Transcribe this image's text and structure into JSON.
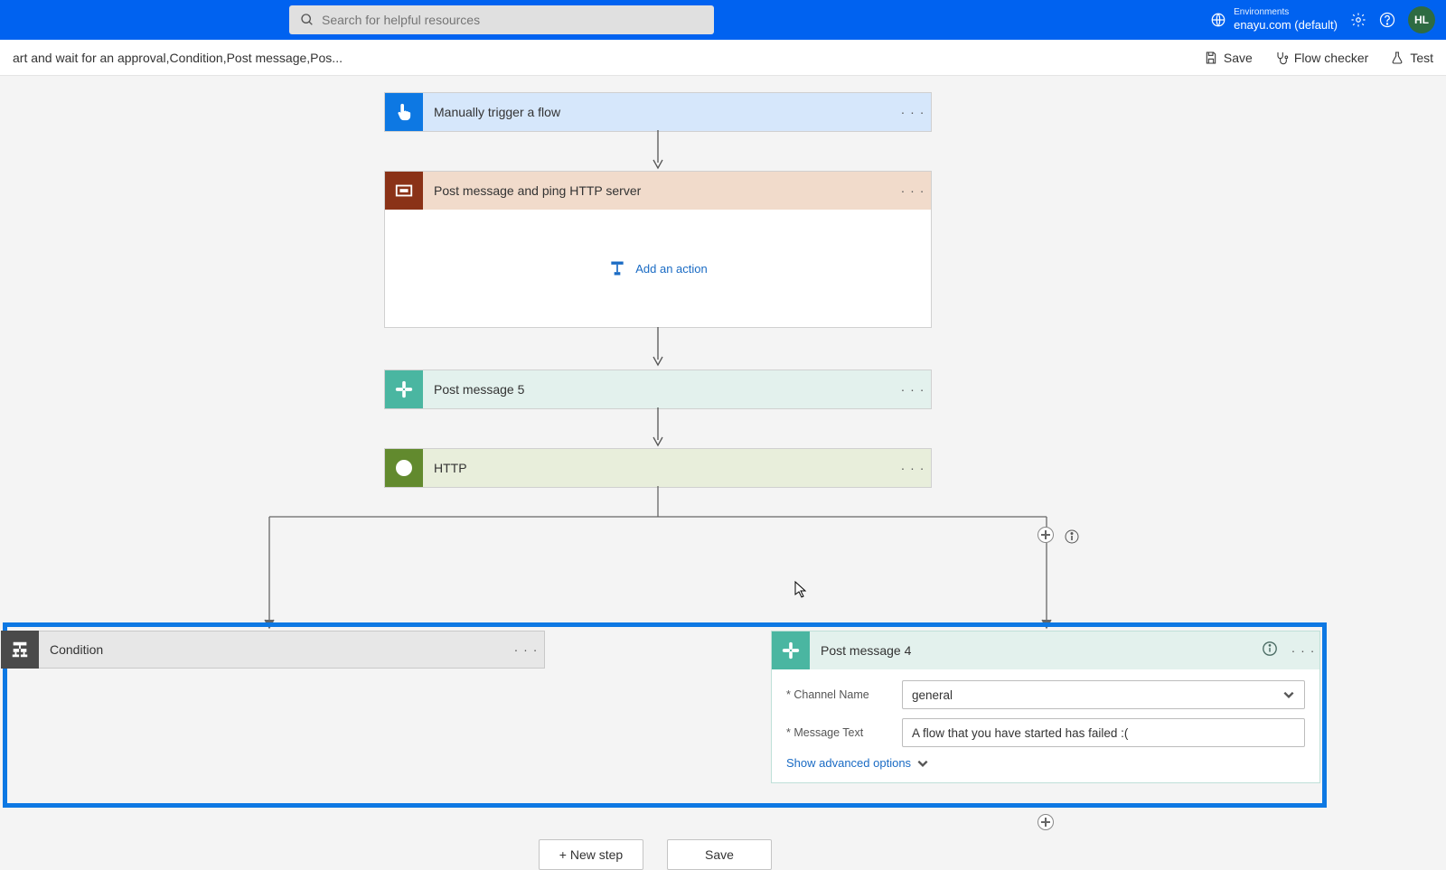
{
  "header": {
    "search_placeholder": "Search for helpful resources",
    "env_label": "Environments",
    "env_value": "enayu.com (default)",
    "avatar": "HL"
  },
  "subbar": {
    "breadcrumb": "art and wait for an approval,Condition,Post message,Pos...",
    "save": "Save",
    "flow_checker": "Flow checker",
    "test": "Test"
  },
  "cards": {
    "c1": "Manually trigger a flow",
    "c2": "Post message and ping HTTP server",
    "c2_add": "Add an action",
    "c3": "Post message 5",
    "c4": "HTTP",
    "cond": "Condition",
    "pm4": "Post message 4"
  },
  "pm4_form": {
    "channel_label": "Channel Name",
    "channel_value": "general",
    "msg_label": "Message Text",
    "msg_value": "A flow that you have started has failed :(",
    "advanced": "Show advanced options"
  },
  "bottom": {
    "new_step": "+ New step",
    "save": "Save"
  }
}
